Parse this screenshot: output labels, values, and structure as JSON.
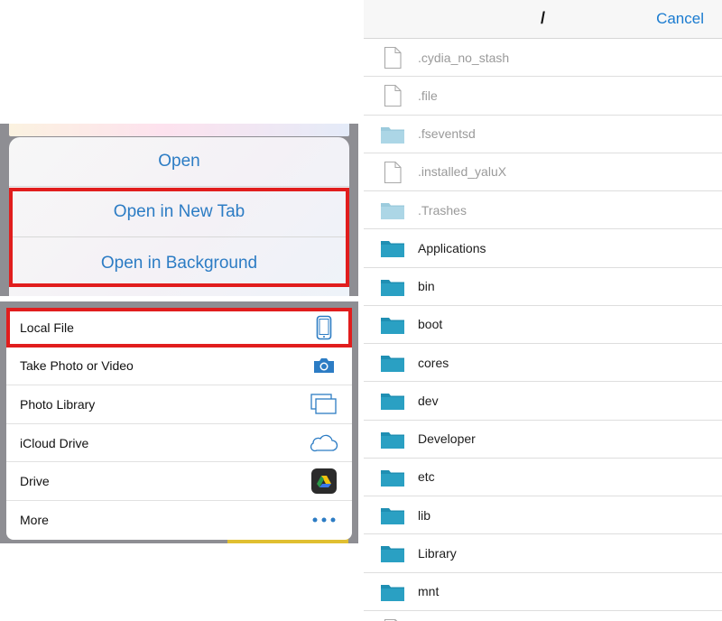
{
  "open_menu": {
    "items": [
      {
        "label": "Open"
      },
      {
        "label": "Open in New Tab"
      },
      {
        "label": "Open in Background"
      }
    ]
  },
  "source_menu": {
    "items": [
      {
        "label": "Local File",
        "icon": "phone-icon"
      },
      {
        "label": "Take Photo or Video",
        "icon": "camera-icon"
      },
      {
        "label": "Photo Library",
        "icon": "photo-library-icon"
      },
      {
        "label": "iCloud Drive",
        "icon": "icloud-icon"
      },
      {
        "label": "Drive",
        "icon": "google-drive-icon"
      },
      {
        "label": "More",
        "icon": "more-icon"
      }
    ]
  },
  "browser": {
    "title": "/",
    "cancel_label": "Cancel",
    "files": [
      {
        "name": ".cydia_no_stash",
        "kind": "file",
        "hidden": true
      },
      {
        "name": ".file",
        "kind": "file",
        "hidden": true
      },
      {
        "name": ".fseventsd",
        "kind": "folder",
        "hidden": true
      },
      {
        "name": ".installed_yaluX",
        "kind": "file",
        "hidden": true
      },
      {
        "name": ".Trashes",
        "kind": "folder",
        "hidden": true
      },
      {
        "name": "Applications",
        "kind": "folder",
        "hidden": false
      },
      {
        "name": "bin",
        "kind": "folder",
        "hidden": false
      },
      {
        "name": "boot",
        "kind": "folder",
        "hidden": false
      },
      {
        "name": "cores",
        "kind": "folder",
        "hidden": false
      },
      {
        "name": "dev",
        "kind": "folder",
        "hidden": false
      },
      {
        "name": "Developer",
        "kind": "folder",
        "hidden": false
      },
      {
        "name": "etc",
        "kind": "folder",
        "hidden": false
      },
      {
        "name": "lib",
        "kind": "folder",
        "hidden": false
      },
      {
        "name": "Library",
        "kind": "folder",
        "hidden": false
      },
      {
        "name": "mnt",
        "kind": "folder",
        "hidden": false
      },
      {
        "name": "",
        "kind": "file",
        "hidden": false
      }
    ]
  },
  "colors": {
    "ios_blue": "#2c7cc4",
    "folder": "#2aa0c3",
    "highlight": "#e11d1d"
  }
}
